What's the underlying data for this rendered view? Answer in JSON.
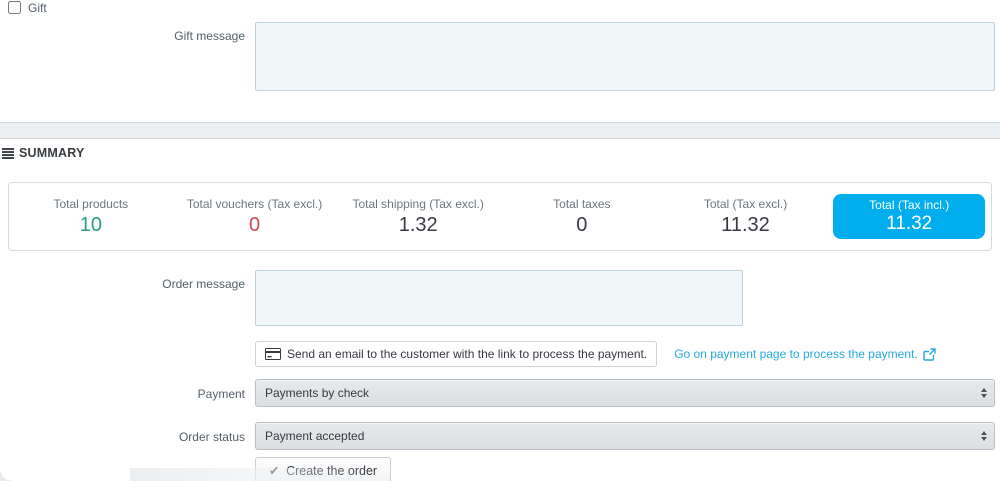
{
  "colors": {
    "accent_badge": "#00aeef",
    "success_value": "#2e9e76",
    "danger_value": "#d0494f",
    "link": "#25a9dd",
    "band_background": "#edeff1",
    "textarea_background": "#f1f6f8",
    "textarea_border": "#bcd3db"
  },
  "icons": {
    "summary_header": "list-lines-icon",
    "email_button": "credit-card-icon",
    "payment_link": "external-link-icon",
    "select_arrows": "up-down-arrows-icon",
    "create_order_check": "✔"
  },
  "gift_section": {
    "gift_checkbox_label": "Gift",
    "gift_checkbox_checked": false,
    "gift_message_label": "Gift message",
    "gift_message_value": ""
  },
  "summary": {
    "header": "SUMMARY",
    "totals": [
      {
        "label": "Total products",
        "value": "10",
        "color": "green"
      },
      {
        "label": "Total vouchers (Tax excl.)",
        "value": "0",
        "color": "red"
      },
      {
        "label": "Total shipping (Tax excl.)",
        "value": "1.32",
        "color": "dark"
      },
      {
        "label": "Total taxes",
        "value": "0",
        "color": "dark"
      },
      {
        "label": "Total (Tax excl.)",
        "value": "11.32",
        "color": "dark"
      },
      {
        "label": "Total (Tax incl.)",
        "value": "11.32",
        "color": "highlight"
      }
    ],
    "order_message_label": "Order message",
    "order_message_value": "",
    "email_button_label": "Send an email to the customer with the link to process the payment.",
    "payment_page_link_label": "Go on payment page to process the payment.",
    "payment_label": "Payment",
    "payment_selected_option": "Payments by check",
    "order_status_label": "Order status",
    "order_status_selected_option": "Payment accepted",
    "create_order_button_label": "Create the order"
  }
}
